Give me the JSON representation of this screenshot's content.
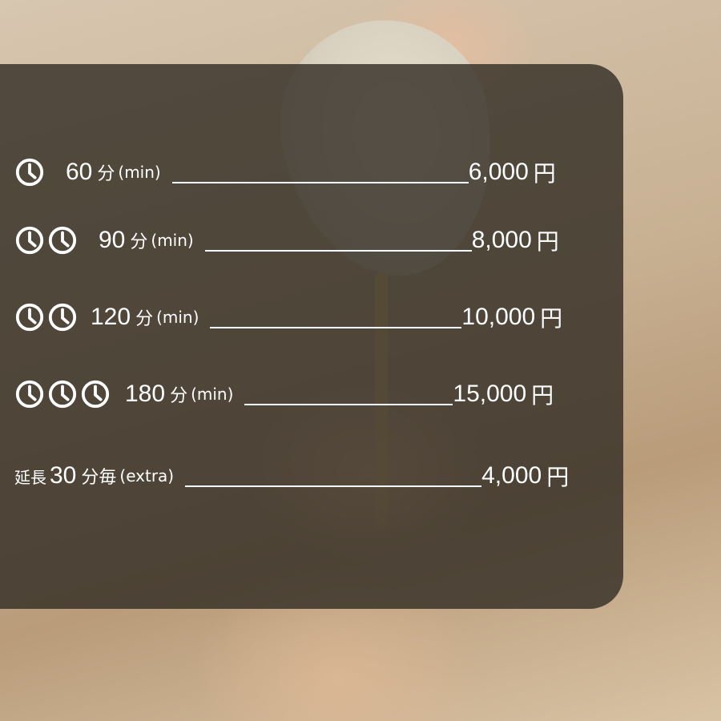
{
  "menu": [
    {
      "clocks": 1,
      "minutes": "60",
      "unit": "分",
      "min_label": "(min)",
      "price": "6,000",
      "currency": "円"
    },
    {
      "clocks": 2,
      "minutes": "90",
      "unit": "分",
      "min_label": "(min)",
      "price": "8,000",
      "currency": "円"
    },
    {
      "clocks": 2,
      "minutes": "120",
      "unit": "分",
      "min_label": "(min)",
      "price": "10,000",
      "currency": "円"
    },
    {
      "clocks": 3,
      "minutes": "180",
      "unit": "分",
      "min_label": "(min)",
      "price": "15,000",
      "currency": "円"
    }
  ],
  "extension": {
    "prefix": "延長",
    "minutes": "30",
    "suffix": "分毎",
    "extra_label": "(extra)",
    "price": "4,000",
    "currency": "円"
  },
  "icon": "clock-icon",
  "overlay_color": "#342e26"
}
